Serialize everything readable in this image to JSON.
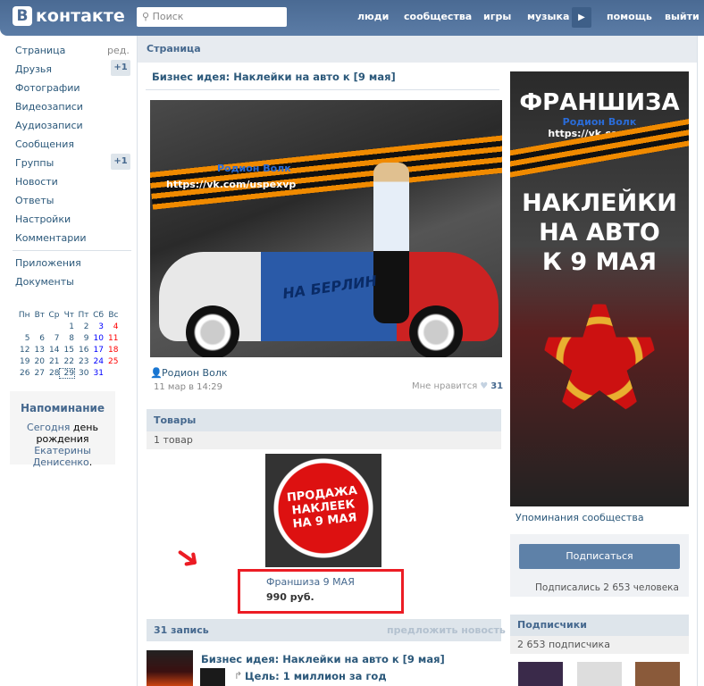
{
  "header": {
    "logo_letter": "В",
    "logo": "контакте",
    "search_placeholder": "Поиск",
    "nav": [
      "люди",
      "сообщества",
      "игры",
      "музыка",
      "помощь",
      "выйти"
    ],
    "more": "▶"
  },
  "sidebar": {
    "items": [
      "Страница",
      "Друзья",
      "Фотографии",
      "Видеозаписи",
      "Аудиозаписи",
      "Сообщения",
      "Группы",
      "Новости",
      "Ответы",
      "Настройки",
      "Комментарии"
    ],
    "edit": "ред.",
    "friends_badge": "+1",
    "groups_badge": "+1",
    "extra": [
      "Приложения",
      "Документы"
    ]
  },
  "calendar": {
    "days": [
      "Пн",
      "Вт",
      "Ср",
      "Чт",
      "Пт",
      "Сб",
      "Вс"
    ],
    "today": "29"
  },
  "reminder": {
    "title": "Напоминание",
    "t1": "Сегодня ",
    "t2": "день",
    "t3": "рождения",
    "t4": " Екатерины",
    "t5": "Денисенко",
    "t6": "."
  },
  "page": {
    "section": "Страница",
    "post_title": "Бизнес идея: Наклейки на авто к [9 мая]",
    "image_author": "Родион Волк",
    "image_url": "https://vk.com/uspexvp",
    "image_car_text": "НА БЕРЛИН",
    "author": "Родион Волк",
    "date": "11 мар в 14:29",
    "likes_label": "Мне нравится",
    "likes": "31"
  },
  "goods": {
    "title": "Товары",
    "count": "1 товар",
    "product_image_text": "ПРОДАЖА НАКЛЕЕК НА 9 МАЯ",
    "product_name": "Франшиза 9 МАЯ",
    "price": "990 руб."
  },
  "wall": {
    "count": "31 запись",
    "suggest": "предложить новость",
    "post_title": "Бизнес идея: Наклейки на авто к [9 мая]",
    "repost": "Цель: 1 миллион за год"
  },
  "banner": {
    "t1": "ФРАНШИЗА",
    "author": "Родион Волк",
    "url": "https://vk.com/uspexvp",
    "t2": "НАКЛЕЙКИ",
    "t3": "НА АВТО",
    "t4": "К 9 МАЯ"
  },
  "right": {
    "mentions": "Упоминания сообщества",
    "subscribe": "Подписаться",
    "subscribed": "Подписались 2 653 человека",
    "followers_title": "Подписчики",
    "followers_count": "2 653 подписчика"
  }
}
